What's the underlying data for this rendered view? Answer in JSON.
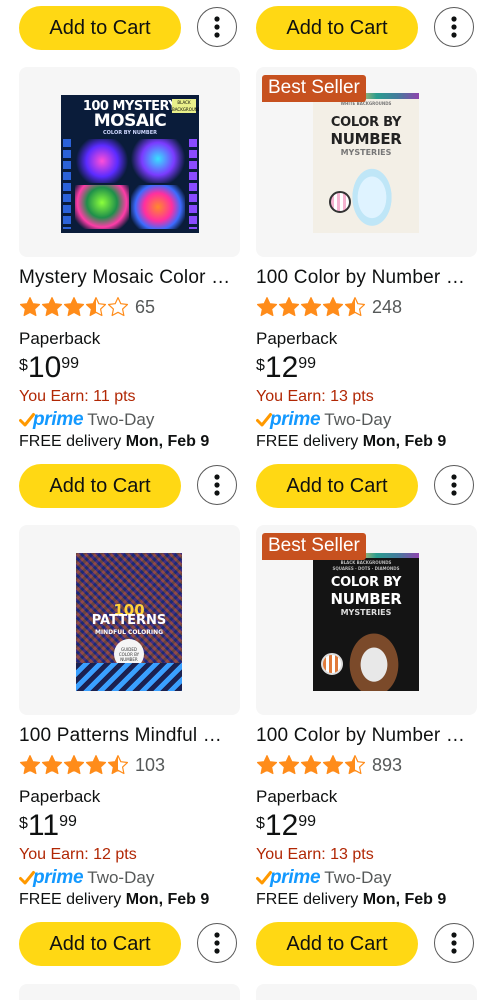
{
  "top_row": {
    "left": {
      "cart_label": "Add to Cart"
    },
    "right": {
      "cart_label": "Add to Cart"
    }
  },
  "products": [
    {
      "badge": "",
      "title": "Mystery Mosaic Color …",
      "rating": 3.5,
      "rating_count": "65",
      "format": "Paperback",
      "price_symbol": "$",
      "price_whole": "10",
      "price_fraction": "99",
      "earn": "You Earn: 11 pts",
      "prime_label": "prime",
      "prime_speed": "Two-Day",
      "delivery_prefix": "FREE delivery",
      "delivery_date": "Mon, Feb 9",
      "cart_label": "Add to Cart",
      "cover": {
        "line1": "100 MYSTERY",
        "line2": "MOSAIC",
        "line3": "COLOR BY NUMBER",
        "tag": "BLACK BACKGROUNDS"
      }
    },
    {
      "badge": "Best Seller",
      "title": "100 Color by Number …",
      "rating": 4.5,
      "rating_count": "248",
      "format": "Paperback",
      "price_symbol": "$",
      "price_whole": "12",
      "price_fraction": "99",
      "earn": "You Earn: 13 pts",
      "prime_label": "prime",
      "prime_speed": "Two-Day",
      "delivery_prefix": "FREE delivery",
      "delivery_date": "Mon, Feb 9",
      "cart_label": "Add to Cart",
      "cover": {
        "line0": "WHITE BACKGROUNDS",
        "line1": "COLOR BY",
        "line2": "NUMBER",
        "line3": "MYSTERIES"
      }
    },
    {
      "badge": "",
      "title": "100 Patterns Mindful …",
      "rating": 4.5,
      "rating_count": "103",
      "format": "Paperback",
      "price_symbol": "$",
      "price_whole": "11",
      "price_fraction": "99",
      "earn": "You Earn: 12 pts",
      "prime_label": "prime",
      "prime_speed": "Two-Day",
      "delivery_prefix": "FREE delivery",
      "delivery_date": "Mon, Feb 9",
      "cart_label": "Add to Cart",
      "cover": {
        "line1": "100",
        "line2": "PATTERNS",
        "line3": "MINDFUL COLORING",
        "tag": "GUIDED COLOR BY NUMBER"
      }
    },
    {
      "badge": "Best Seller",
      "title": "100 Color by Number …",
      "rating": 4.5,
      "rating_count": "893",
      "format": "Paperback",
      "price_symbol": "$",
      "price_whole": "12",
      "price_fraction": "99",
      "earn": "You Earn: 13 pts",
      "prime_label": "prime",
      "prime_speed": "Two-Day",
      "delivery_prefix": "FREE delivery",
      "delivery_date": "Mon, Feb 9",
      "cart_label": "Add to Cart",
      "cover": {
        "line0": "BLACK BACKGROUNDS",
        "line0b": "SQUARES · DOTS · DIAMONDS",
        "line1": "COLOR BY",
        "line2": "NUMBER",
        "line3": "MYSTERIES"
      }
    }
  ],
  "colors": {
    "cart_button": "#ffd814",
    "badge": "#c7511f",
    "star": "#ff8c1a",
    "earn": "#b12704",
    "prime": "#1399ff",
    "check": "#ff9900"
  },
  "icons": {
    "more": "vertical-ellipsis-icon",
    "star": "star-icon",
    "prime_check": "prime-check-icon"
  }
}
